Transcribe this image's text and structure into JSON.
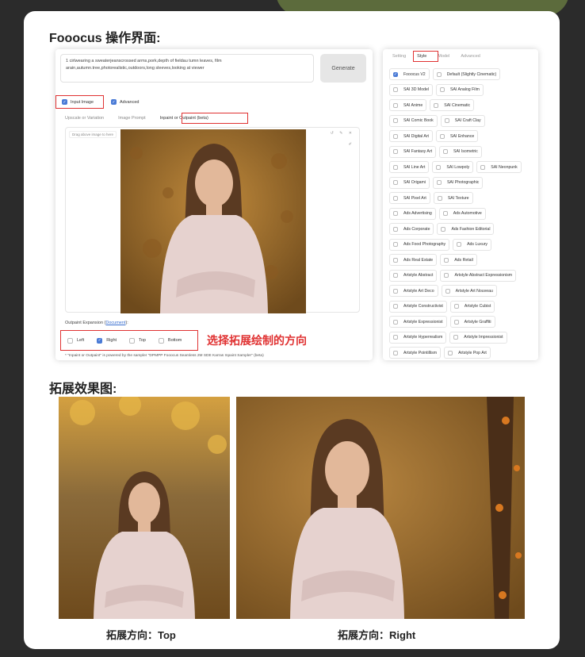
{
  "headings": {
    "ui_title": "Fooocus 操作界面:",
    "result_title": "拓展效果图:"
  },
  "prompt": {
    "text": "1 cirlwearing a sweaterjeanscrossed arms,pork,depth of fieldau tumn leaves, film arain,autumn.tree,photorealistic,outdoors,long sleeves,looking at viewer"
  },
  "generate_label": "Generate",
  "options": {
    "input_image": "Input Image",
    "advanced": "Advanced"
  },
  "image_tabs": [
    "Upscale or Variation",
    "Image Prompt",
    "Inpaint or Outpaint (beta)"
  ],
  "drop_hint": "Drag above image to here",
  "image_controls": "↺ ✎ ✕",
  "outpaint": {
    "label": "Outpaint Expansion (",
    "doc_link": "Document",
    "label_end": "):",
    "directions": [
      {
        "label": "Left",
        "checked": false
      },
      {
        "label": "Right",
        "checked": true
      },
      {
        "label": "Top",
        "checked": false
      },
      {
        "label": "Bottom",
        "checked": false
      }
    ],
    "annotation": "选择拓展绘制的方向",
    "footnote": "* \"Inpaint or Outpaint\" is powered by the sampler \"DPMPP Fooocus Seamless 2M SDE Karras Inpaint Sampler\" (beta)"
  },
  "settings_tabs": [
    "Setting",
    "Style",
    "Model",
    "Advanced"
  ],
  "styles": [
    [
      {
        "label": "Fooocus V2",
        "checked": true
      },
      {
        "label": "Default (Slightly Cinematic)",
        "checked": false
      }
    ],
    [
      {
        "label": "SAI 3D Model",
        "checked": false
      },
      {
        "label": "SAI Analog Film",
        "checked": false
      }
    ],
    [
      {
        "label": "SAI Anime",
        "checked": false
      },
      {
        "label": "SAI Cinematic",
        "checked": false
      }
    ],
    [
      {
        "label": "SAI Comic Book",
        "checked": false
      },
      {
        "label": "SAI Craft Clay",
        "checked": false
      }
    ],
    [
      {
        "label": "SAI Digital Art",
        "checked": false
      },
      {
        "label": "SAI Enhance",
        "checked": false
      }
    ],
    [
      {
        "label": "SAI Fantasy Art",
        "checked": false
      },
      {
        "label": "SAI Isometric",
        "checked": false
      }
    ],
    [
      {
        "label": "SAI Line Art",
        "checked": false
      },
      {
        "label": "SAI Lowpoly",
        "checked": false
      },
      {
        "label": "SAI Neonpunk",
        "checked": false
      }
    ],
    [
      {
        "label": "SAI Origami",
        "checked": false
      },
      {
        "label": "SAI Photographic",
        "checked": false
      }
    ],
    [
      {
        "label": "SAI Pixel Art",
        "checked": false
      },
      {
        "label": "SAI Texture",
        "checked": false
      }
    ],
    [
      {
        "label": "Ads Advertising",
        "checked": false
      },
      {
        "label": "Ads Automotive",
        "checked": false
      }
    ],
    [
      {
        "label": "Ads Corporate",
        "checked": false
      },
      {
        "label": "Ads Fashion Editorial",
        "checked": false
      }
    ],
    [
      {
        "label": "Ads Food Photography",
        "checked": false
      },
      {
        "label": "Ads Luxury",
        "checked": false
      }
    ],
    [
      {
        "label": "Ads Real Estate",
        "checked": false
      },
      {
        "label": "Ads Retail",
        "checked": false
      }
    ],
    [
      {
        "label": "Artstyle Abstract",
        "checked": false
      },
      {
        "label": "Artstyle Abstract Expressionism",
        "checked": false
      }
    ],
    [
      {
        "label": "Artstyle Art Deco",
        "checked": false
      },
      {
        "label": "Artstyle Art Nouveau",
        "checked": false
      }
    ],
    [
      {
        "label": "Artstyle Constructivist",
        "checked": false
      },
      {
        "label": "Artstyle Cubist",
        "checked": false
      }
    ],
    [
      {
        "label": "Artstyle Expressionist",
        "checked": false
      },
      {
        "label": "Artstyle Graffiti",
        "checked": false
      }
    ],
    [
      {
        "label": "Artstyle Hyperrealism",
        "checked": false
      },
      {
        "label": "Artstyle Impressionist",
        "checked": false
      }
    ],
    [
      {
        "label": "Artstyle Pointillism",
        "checked": false
      },
      {
        "label": "Artstyle Pop Art",
        "checked": false
      }
    ]
  ],
  "captions": {
    "top": "拓展方向：Top",
    "right": "拓展方向：Right"
  },
  "colors": {
    "accent": "#4a7bd6",
    "highlight": "#e03232",
    "autumn_bg": "#9a6a25",
    "sweater": "#e6d2cf",
    "hair": "#5a3a22"
  }
}
